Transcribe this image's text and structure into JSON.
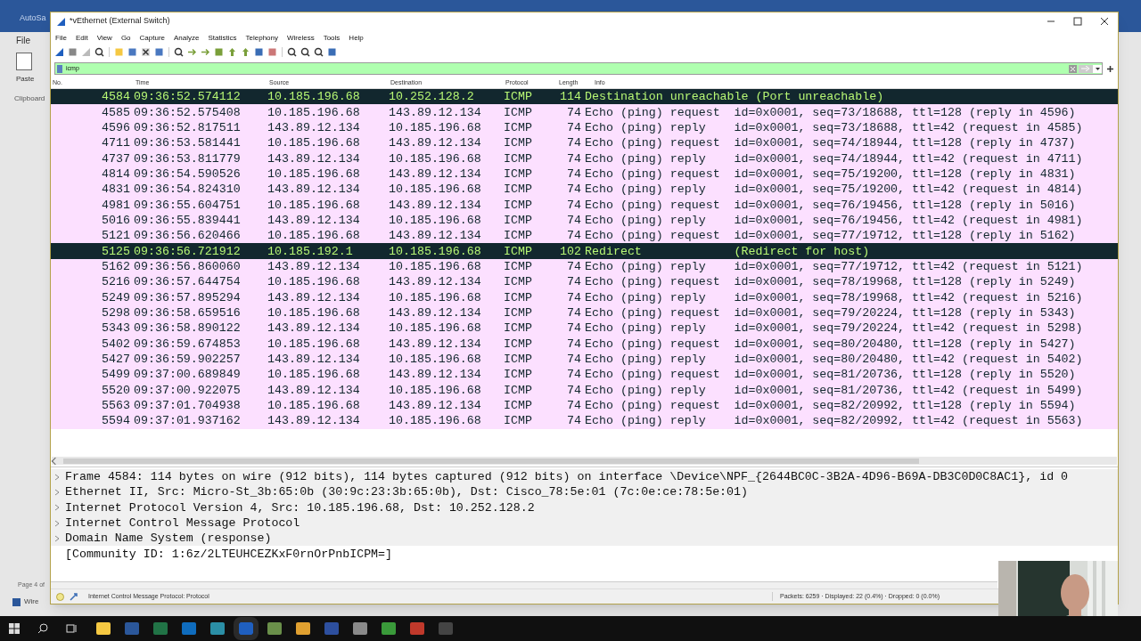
{
  "background_window": {
    "title": "AutoSa",
    "menu": "File",
    "paste": "Paste",
    "group": "Clipboard",
    "status": "Page 4 of",
    "footer": "Wire"
  },
  "window": {
    "title": "*vEthernet (External Switch)"
  },
  "menu": [
    "File",
    "Edit",
    "View",
    "Go",
    "Capture",
    "Analyze",
    "Statistics",
    "Telephony",
    "Wireless",
    "Tools",
    "Help"
  ],
  "filter": {
    "value": "icmp"
  },
  "columns": [
    "No.",
    "Time",
    "Source",
    "Destination",
    "Protocol",
    "Length",
    "Info"
  ],
  "rows": [
    {
      "no": "4584",
      "time": "09:36:52.574112",
      "source": "10.185.196.68",
      "destination": "10.252.128.2",
      "protocol": "ICMP",
      "length": "114",
      "info": "Destination unreachable (Port unreachable)",
      "kind": "error"
    },
    {
      "no": "4585",
      "time": "09:36:52.575408",
      "source": "10.185.196.68",
      "destination": "143.89.12.134",
      "protocol": "ICMP",
      "length": "74",
      "info": "Echo (ping) request  id=0x0001, seq=73/18688, ttl=128 (reply in 4596)",
      "kind": "normal"
    },
    {
      "no": "4596",
      "time": "09:36:52.817511",
      "source": "143.89.12.134",
      "destination": "10.185.196.68",
      "protocol": "ICMP",
      "length": "74",
      "info": "Echo (ping) reply    id=0x0001, seq=73/18688, ttl=42 (request in 4585)",
      "kind": "normal"
    },
    {
      "no": "4711",
      "time": "09:36:53.581441",
      "source": "10.185.196.68",
      "destination": "143.89.12.134",
      "protocol": "ICMP",
      "length": "74",
      "info": "Echo (ping) request  id=0x0001, seq=74/18944, ttl=128 (reply in 4737)",
      "kind": "normal"
    },
    {
      "no": "4737",
      "time": "09:36:53.811779",
      "source": "143.89.12.134",
      "destination": "10.185.196.68",
      "protocol": "ICMP",
      "length": "74",
      "info": "Echo (ping) reply    id=0x0001, seq=74/18944, ttl=42 (request in 4711)",
      "kind": "normal"
    },
    {
      "no": "4814",
      "time": "09:36:54.590526",
      "source": "10.185.196.68",
      "destination": "143.89.12.134",
      "protocol": "ICMP",
      "length": "74",
      "info": "Echo (ping) request  id=0x0001, seq=75/19200, ttl=128 (reply in 4831)",
      "kind": "normal"
    },
    {
      "no": "4831",
      "time": "09:36:54.824310",
      "source": "143.89.12.134",
      "destination": "10.185.196.68",
      "protocol": "ICMP",
      "length": "74",
      "info": "Echo (ping) reply    id=0x0001, seq=75/19200, ttl=42 (request in 4814)",
      "kind": "normal"
    },
    {
      "no": "4981",
      "time": "09:36:55.604751",
      "source": "10.185.196.68",
      "destination": "143.89.12.134",
      "protocol": "ICMP",
      "length": "74",
      "info": "Echo (ping) request  id=0x0001, seq=76/19456, ttl=128 (reply in 5016)",
      "kind": "normal"
    },
    {
      "no": "5016",
      "time": "09:36:55.839441",
      "source": "143.89.12.134",
      "destination": "10.185.196.68",
      "protocol": "ICMP",
      "length": "74",
      "info": "Echo (ping) reply    id=0x0001, seq=76/19456, ttl=42 (request in 4981)",
      "kind": "normal"
    },
    {
      "no": "5121",
      "time": "09:36:56.620466",
      "source": "10.185.196.68",
      "destination": "143.89.12.134",
      "protocol": "ICMP",
      "length": "74",
      "info": "Echo (ping) request  id=0x0001, seq=77/19712, ttl=128 (reply in 5162)",
      "kind": "normal"
    },
    {
      "no": "5125",
      "time": "09:36:56.721912",
      "source": "10.185.192.1",
      "destination": "10.185.196.68",
      "protocol": "ICMP",
      "length": "102",
      "info": "Redirect             (Redirect for host)",
      "kind": "error"
    },
    {
      "no": "5162",
      "time": "09:36:56.860060",
      "source": "143.89.12.134",
      "destination": "10.185.196.68",
      "protocol": "ICMP",
      "length": "74",
      "info": "Echo (ping) reply    id=0x0001, seq=77/19712, ttl=42 (request in 5121)",
      "kind": "normal"
    },
    {
      "no": "5216",
      "time": "09:36:57.644754",
      "source": "10.185.196.68",
      "destination": "143.89.12.134",
      "protocol": "ICMP",
      "length": "74",
      "info": "Echo (ping) request  id=0x0001, seq=78/19968, ttl=128 (reply in 5249)",
      "kind": "normal"
    },
    {
      "no": "5249",
      "time": "09:36:57.895294",
      "source": "143.89.12.134",
      "destination": "10.185.196.68",
      "protocol": "ICMP",
      "length": "74",
      "info": "Echo (ping) reply    id=0x0001, seq=78/19968, ttl=42 (request in 5216)",
      "kind": "normal"
    },
    {
      "no": "5298",
      "time": "09:36:58.659516",
      "source": "10.185.196.68",
      "destination": "143.89.12.134",
      "protocol": "ICMP",
      "length": "74",
      "info": "Echo (ping) request  id=0x0001, seq=79/20224, ttl=128 (reply in 5343)",
      "kind": "normal"
    },
    {
      "no": "5343",
      "time": "09:36:58.890122",
      "source": "143.89.12.134",
      "destination": "10.185.196.68",
      "protocol": "ICMP",
      "length": "74",
      "info": "Echo (ping) reply    id=0x0001, seq=79/20224, ttl=42 (request in 5298)",
      "kind": "normal"
    },
    {
      "no": "5402",
      "time": "09:36:59.674853",
      "source": "10.185.196.68",
      "destination": "143.89.12.134",
      "protocol": "ICMP",
      "length": "74",
      "info": "Echo (ping) request  id=0x0001, seq=80/20480, ttl=128 (reply in 5427)",
      "kind": "normal"
    },
    {
      "no": "5427",
      "time": "09:36:59.902257",
      "source": "143.89.12.134",
      "destination": "10.185.196.68",
      "protocol": "ICMP",
      "length": "74",
      "info": "Echo (ping) reply    id=0x0001, seq=80/20480, ttl=42 (request in 5402)",
      "kind": "normal"
    },
    {
      "no": "5499",
      "time": "09:37:00.689849",
      "source": "10.185.196.68",
      "destination": "143.89.12.134",
      "protocol": "ICMP",
      "length": "74",
      "info": "Echo (ping) request  id=0x0001, seq=81/20736, ttl=128 (reply in 5520)",
      "kind": "normal"
    },
    {
      "no": "5520",
      "time": "09:37:00.922075",
      "source": "143.89.12.134",
      "destination": "10.185.196.68",
      "protocol": "ICMP",
      "length": "74",
      "info": "Echo (ping) reply    id=0x0001, seq=81/20736, ttl=42 (request in 5499)",
      "kind": "normal"
    },
    {
      "no": "5563",
      "time": "09:37:01.704938",
      "source": "10.185.196.68",
      "destination": "143.89.12.134",
      "protocol": "ICMP",
      "length": "74",
      "info": "Echo (ping) request  id=0x0001, seq=82/20992, ttl=128 (reply in 5594)",
      "kind": "normal"
    },
    {
      "no": "5594",
      "time": "09:37:01.937162",
      "source": "143.89.12.134",
      "destination": "10.185.196.68",
      "protocol": "ICMP",
      "length": "74",
      "info": "Echo (ping) reply    id=0x0001, seq=82/20992, ttl=42 (request in 5563)",
      "kind": "normal"
    }
  ],
  "details": [
    {
      "text": "Frame 4584: 114 bytes on wire (912 bits), 114 bytes captured (912 bits) on interface \\Device\\NPF_{2644BC0C-3B2A-4D96-B69A-DB3C0D0C8AC1}, id 0",
      "expandable": true
    },
    {
      "text": "Ethernet II, Src: Micro-St_3b:65:0b (30:9c:23:3b:65:0b), Dst: Cisco_78:5e:01 (7c:0e:ce:78:5e:01)",
      "expandable": true
    },
    {
      "text": "Internet Protocol Version 4, Src: 10.185.196.68, Dst: 10.252.128.2",
      "expandable": true
    },
    {
      "text": "Internet Control Message Protocol",
      "expandable": true
    },
    {
      "text": "Domain Name System (response)",
      "expandable": true
    },
    {
      "text": "[Community ID: 1:6z/2LTEUHCEZKxF0rnOrPnbICPM=]",
      "expandable": false
    }
  ],
  "status_bar": {
    "text": "Internet Control Message Protocol: Protocol",
    "stats": "Packets: 6259 · Displayed: 22 (0.4%) · Dropped: 0 (0.0%)"
  }
}
